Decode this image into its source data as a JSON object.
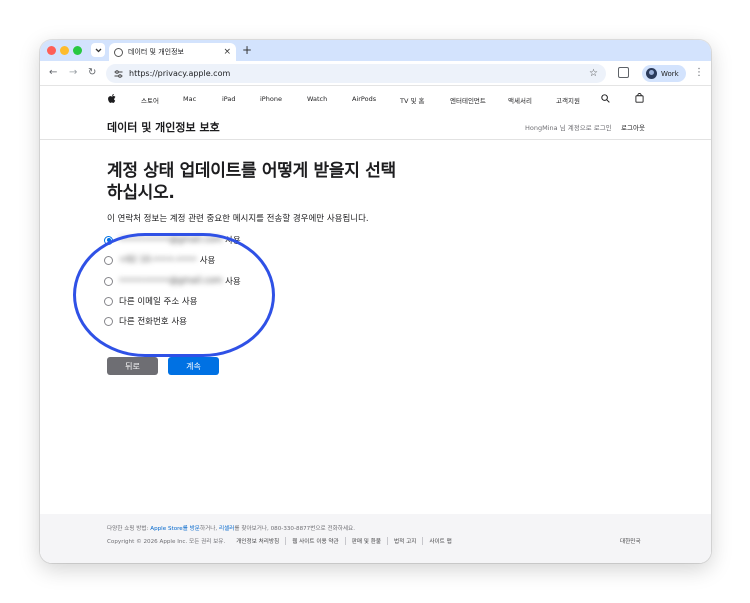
{
  "browser": {
    "tab_title": "데이터 및 개인정보",
    "tab_close": "×",
    "new_tab": "+",
    "url": "https://privacy.apple.com",
    "profile_label": "Work",
    "back_glyph": "←",
    "forward_glyph": "→",
    "reload_glyph": "↻",
    "star_glyph": "☆",
    "menu_glyph": "⋮"
  },
  "apple_nav": {
    "items": [
      "스토어",
      "Mac",
      "iPad",
      "iPhone",
      "Watch",
      "AirPods",
      "TV 및 홈",
      "엔터테인먼트",
      "액세서리",
      "고객지원"
    ]
  },
  "subheader": {
    "title": "데이터 및 개인정보 보호",
    "signed_in": "HongMina 님 계정으로 로그인",
    "logout": "로그아웃"
  },
  "main": {
    "heading": "계정 상태 업데이트를 어떻게 받을지 선택하십시오.",
    "description": "이 연락처 정보는 계정 관련 중요한 메시지를 전송할 경우에만 사용됩니다.",
    "options": [
      {
        "masked": "••••••••••@gmail.com",
        "suffix": "사용",
        "checked": true
      },
      {
        "masked": "+82 10-••••-••••",
        "suffix": "사용",
        "checked": false
      },
      {
        "masked": "••••••••••@gmail.com",
        "suffix": "사용",
        "checked": false
      },
      {
        "label": "다른 이메일 주소 사용",
        "checked": false
      },
      {
        "label": "다른 전화번호 사용",
        "checked": false
      }
    ],
    "back_button": "뒤로",
    "continue_button": "계속"
  },
  "footer": {
    "line1_prefix": "다양한 쇼핑 방법: ",
    "line1_link1": "Apple Store를 방문",
    "line1_mid": "하거나, ",
    "line1_link2": "리셀러",
    "line1_suffix": "를 찾아보거나, 080-330-8877번으로 전화하세요.",
    "copyright": "Copyright © 2026 Apple Inc. 모든 권리 보유.",
    "links": [
      "개인정보 처리방침",
      "웹 사이트 이용 약관",
      "판매 및 환불",
      "법적 고지",
      "사이트 맵"
    ],
    "region": "대한민국"
  },
  "colors": {
    "accent": "#0071e3",
    "highlight_ring": "#2f51e6",
    "tabbar": "#d3e3fd"
  }
}
